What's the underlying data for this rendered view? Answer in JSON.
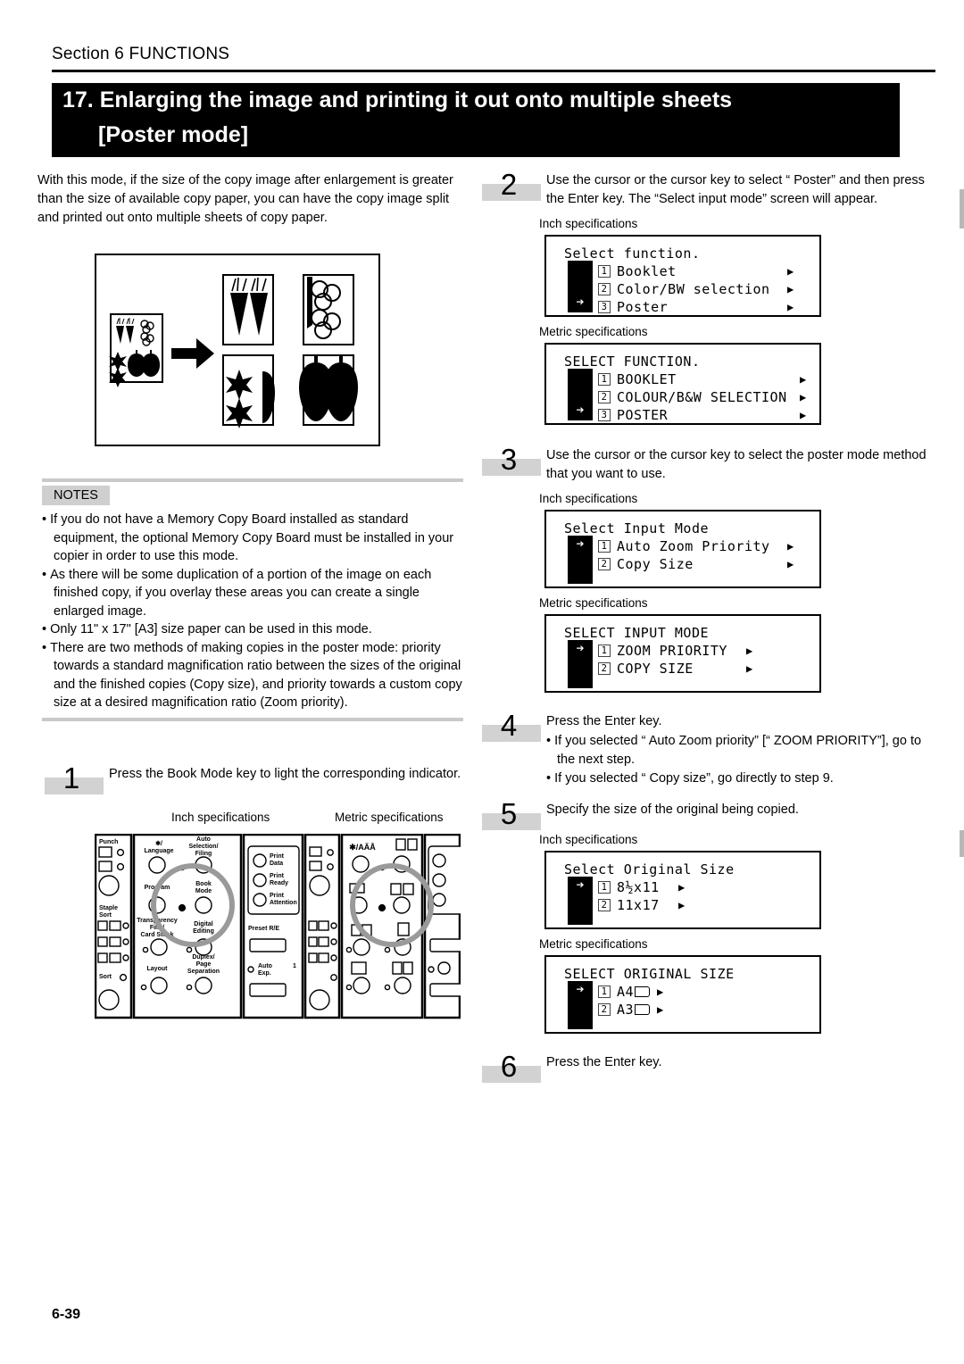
{
  "header": {
    "section": "Section 6  FUNCTIONS",
    "title_line1": "17. Enlarging the image and printing it out onto multiple sheets",
    "title_line2": "[Poster mode]"
  },
  "intro": "With this mode, if the size of the copy image after enlargement is greater than the size of available copy paper, you can have the copy image split and printed out onto multiple sheets of copy paper.",
  "illustration": {
    "name": "poster-split-diagram",
    "description": "Original document with vegetables enlarged and split onto four sheets",
    "arrow": "right-arrow-icon"
  },
  "notes": {
    "label": "NOTES",
    "items": [
      "If you do not have a Memory Copy Board installed as standard equipment, the optional Memory Copy Board must be installed in your copier in order to use this mode.",
      "As there will be some duplication of a portion of the image on each finished copy, if you overlay these areas you can create a single enlarged image.",
      "Only 11\" x 17\" [A3] size paper can be used in this mode.",
      "There are two methods of making copies in the poster mode: priority towards a standard magnification ratio between the sizes of the original and the finished copies (Copy size), and priority towards a custom copy size at a desired magnification ratio (Zoom priority)."
    ]
  },
  "labels": {
    "inch": "Inch specifications",
    "metric": "Metric specifications"
  },
  "steps": {
    "s1": {
      "num": "1",
      "text": "Press the Book Mode key to light the corresponding indicator."
    },
    "s2": {
      "num": "2",
      "text": "Use the    cursor or the    cursor key to select “   Poster” and then press the Enter key. The “Select input mode” screen will appear."
    },
    "s3": {
      "num": "3",
      "text": "Use the    cursor or the    cursor key to select the poster mode method that you want to use."
    },
    "s4": {
      "num": "4",
      "text": "Press the Enter key.",
      "subs": [
        "If you selected “    Auto Zoom priority” [“    ZOOM PRIORITY”], go to the next step.",
        "If you selected “    Copy size”, go directly to step 9."
      ]
    },
    "s5": {
      "num": "5",
      "text": "Specify the size of the original being copied."
    },
    "s6": {
      "num": "6",
      "text": "Press the Enter key."
    }
  },
  "lcd_panels": {
    "select_function_inch": {
      "title": "Select function.",
      "cursor_row": 3,
      "rows": [
        {
          "idx": "1",
          "text": "Booklet",
          "arrow": "▶"
        },
        {
          "idx": "2",
          "text": "Color/BW selection",
          "arrow": "▶"
        },
        {
          "idx": "3",
          "text": "Poster",
          "arrow": "▶"
        }
      ]
    },
    "select_function_metric": {
      "title": "SELECT FUNCTION.",
      "cursor_row": 3,
      "rows": [
        {
          "idx": "1",
          "text": "BOOKLET",
          "arrow": "▶"
        },
        {
          "idx": "2",
          "text": "COLOUR/B&W SELECTION",
          "arrow": "▶"
        },
        {
          "idx": "3",
          "text": "POSTER",
          "arrow": "▶"
        }
      ]
    },
    "select_input_inch": {
      "title": "Select Input Mode",
      "cursor_row": 1,
      "rows": [
        {
          "idx": "1",
          "text": "Auto Zoom Priority",
          "arrow": "▶"
        },
        {
          "idx": "2",
          "text": "Copy Size",
          "arrow": "▶"
        }
      ]
    },
    "select_input_metric": {
      "title": "SELECT INPUT MODE",
      "cursor_row": 1,
      "rows": [
        {
          "idx": "1",
          "text": "ZOOM PRIORITY",
          "arrow": "▶"
        },
        {
          "idx": "2",
          "text": "COPY SIZE",
          "arrow": "▶"
        }
      ]
    },
    "select_orig_inch": {
      "title": "Select Original Size",
      "cursor_row": 1,
      "rows": [
        {
          "idx": "1",
          "text": "8½x11",
          "arrow": "▶"
        },
        {
          "idx": "2",
          "text": "11x17",
          "arrow": "▶"
        }
      ]
    },
    "select_orig_metric": {
      "title": "SELECT ORIGINAL SIZE",
      "cursor_row": 1,
      "rows": [
        {
          "idx": "1",
          "text": "A4",
          "icon": "paper-landscape-icon",
          "arrow": "▶"
        },
        {
          "idx": "2",
          "text": "A3",
          "icon": "paper-landscape-icon",
          "arrow": "▶"
        }
      ]
    }
  },
  "control_panel": {
    "inch_labels": [
      "Punch",
      "Staple Sort",
      "Sort",
      "✱/ Language",
      "Auto Selection/ Filing",
      "Program",
      "Book Mode",
      "Transparency Film/ Card Stock",
      "Digital Editing",
      "Layout",
      "Duplex/ Page Separation",
      "Print Data",
      "Print Ready",
      "Print Attention",
      "Preset R/E",
      "Auto Exp.",
      "1"
    ],
    "highlight": "book-mode-key",
    "metric_labels": [
      "✱/AÄÅ",
      "Preset R/E",
      "Auto Exp.",
      "1"
    ]
  },
  "page_number": "6-39"
}
